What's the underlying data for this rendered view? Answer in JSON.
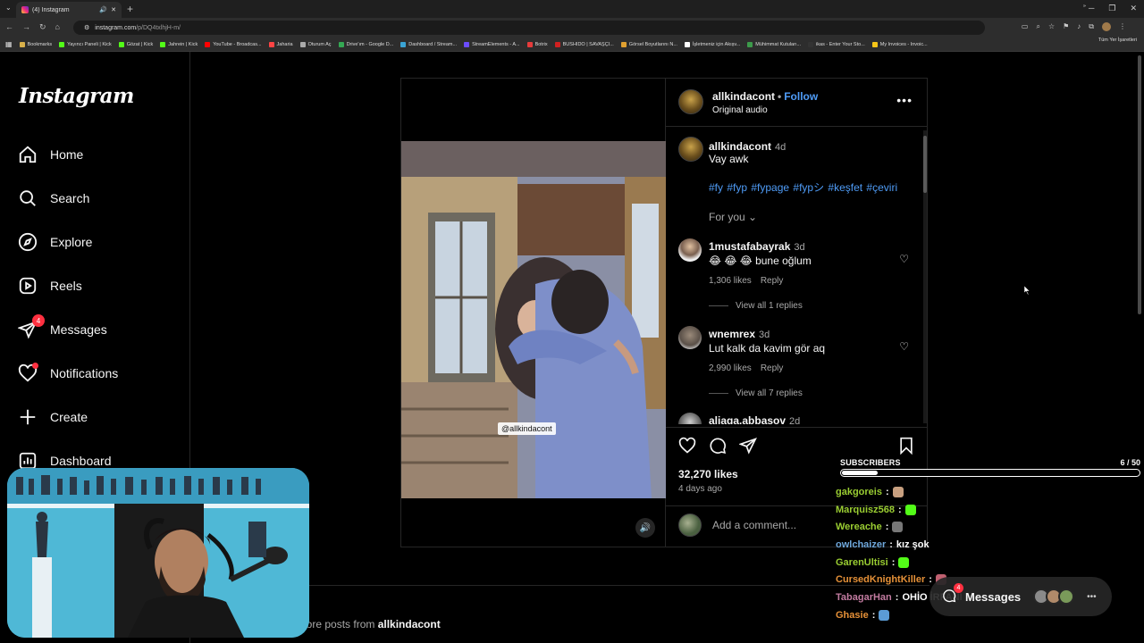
{
  "browser": {
    "tab_title": "(4) Instagram",
    "url_host": "instagram.com",
    "url_path": "/p/DQ4txlhjH-m/",
    "bookmarks": [
      {
        "label": "Bookmarks",
        "color": "#d8b04a"
      },
      {
        "label": "Yayıncı Paneli | Kick",
        "color": "#53fc18"
      },
      {
        "label": "Gözat | Kick",
        "color": "#53fc18"
      },
      {
        "label": "Jahrein | Kick",
        "color": "#53fc18"
      },
      {
        "label": "YouTube - Broadcas...",
        "color": "#ff0000"
      },
      {
        "label": "Jaharia",
        "color": "#ff4444"
      },
      {
        "label": "Oturum Aç",
        "color": "#aaaaaa"
      },
      {
        "label": "Drive'ım - Google D...",
        "color": "#34a853"
      },
      {
        "label": "Dashboard / Stream...",
        "color": "#3aa3d4"
      },
      {
        "label": "StreamElements - A...",
        "color": "#6b4cff"
      },
      {
        "label": "Botrix",
        "color": "#e63b3b"
      },
      {
        "label": "BUSHIDO | SAVAŞÇI...",
        "color": "#d02020"
      },
      {
        "label": "Görsel Boyutlarını N...",
        "color": "#e0a030"
      },
      {
        "label": "İşletmeniz için Akıșv...",
        "color": "#ffffff"
      },
      {
        "label": "Mühimmat Kutuları...",
        "color": "#3c9a4a"
      },
      {
        "label": "ikas - Enter Your Sto...",
        "color": "#333333"
      },
      {
        "label": "My Invoices - Invoic...",
        "color": "#f5c518"
      }
    ],
    "all_bookmarks": "Tüm Yer İşaretleri"
  },
  "sidebar": {
    "logo": "Instagram",
    "items": [
      {
        "label": "Home"
      },
      {
        "label": "Search"
      },
      {
        "label": "Explore"
      },
      {
        "label": "Reels"
      },
      {
        "label": "Messages",
        "badge": "4"
      },
      {
        "label": "Notifications"
      },
      {
        "label": "Create"
      },
      {
        "label": "Dashboard"
      }
    ]
  },
  "post": {
    "author": "allkindacont",
    "follow_label": "Follow",
    "audio": "Original audio",
    "more": "•••",
    "watermark": "@allkindacont",
    "caption": {
      "user": "allkindacont",
      "time": "4d",
      "text": "Vay awk",
      "hashtags": "#fy #fyp #fypage #fypシ #keşfet #çeviri"
    },
    "for_you": "For you",
    "comments": [
      {
        "user": "1mustafabayrak",
        "time": "3d",
        "text": "😂 😂 😂 bune oğlum",
        "likes": "1,306 likes",
        "reply": "Reply",
        "view_replies": "View all 1 replies"
      },
      {
        "user": "wnemrex",
        "time": "3d",
        "text": "Lut kalk da kavim gör aq",
        "likes": "2,990 likes",
        "reply": "Reply",
        "view_replies": "View all 7 replies"
      },
      {
        "user": "aliaga.abbasov",
        "time": "2d"
      }
    ],
    "likes_count": "32,270 likes",
    "posted": "4 days ago",
    "add_comment_placeholder": "Add a comment..."
  },
  "more_posts": {
    "prefix": "lore posts from",
    "author": "allkindacont"
  },
  "stream_overlay": {
    "subscribers_label": "SUBSCRIBERS",
    "subscribers_count": "6 / 50",
    "subscribers_progress": 0.12,
    "chat": [
      {
        "user": "gakgoreis",
        "color": "#9acd32",
        "text": "",
        "emote_color": "#c8a080"
      },
      {
        "user": "Marquisz568",
        "color": "#9acd32",
        "text": "",
        "emote_color": "#53fc18"
      },
      {
        "user": "Wereache",
        "color": "#9acd32",
        "text": "",
        "emote_color": "#777777"
      },
      {
        "user": "owlchaizer",
        "color": "#6fa8dc",
        "text": "kız şok",
        "emote_color": ""
      },
      {
        "user": "GarenUltisi",
        "color": "#9acd32",
        "text": "",
        "emote_color": "#53fc18"
      },
      {
        "user": "CursedKnightKiller",
        "color": "#e69138",
        "text": "",
        "emote_color": "#c06070"
      },
      {
        "user": "TabagarHan",
        "color": "#c27ba0",
        "text": "OHİO İRFANI",
        "emote_color": ""
      },
      {
        "user": "Ghasie",
        "color": "#e69138",
        "text": "",
        "emote_color": "#5b9bd5"
      }
    ]
  },
  "messages_pill": {
    "label": "Messages",
    "badge": "4"
  }
}
